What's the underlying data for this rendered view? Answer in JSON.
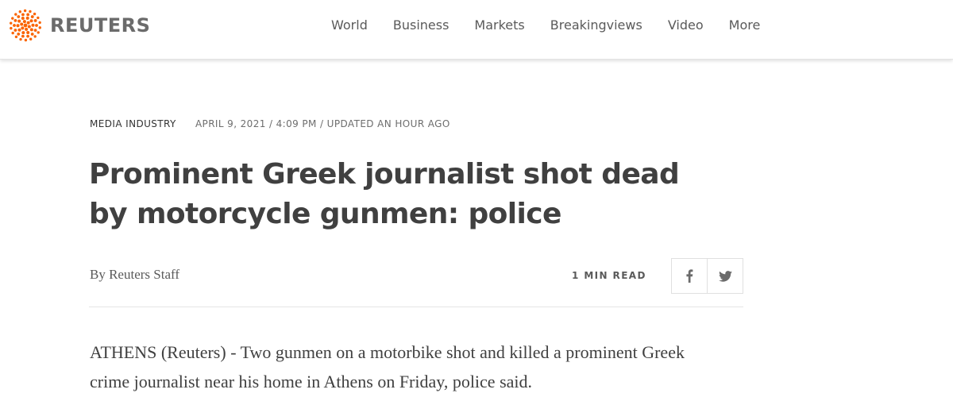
{
  "brand": {
    "name": "REUTERS",
    "logo_icon": "reuters-dot-logo-icon",
    "accent_color": "#fa6400"
  },
  "nav": {
    "items": [
      {
        "label": "World"
      },
      {
        "label": "Business"
      },
      {
        "label": "Markets"
      },
      {
        "label": "Breakingviews"
      },
      {
        "label": "Video"
      },
      {
        "label": "More"
      }
    ]
  },
  "article": {
    "channel": "MEDIA INDUSTRY",
    "timestamp": "APRIL 9, 2021 / 4:09 PM / UPDATED AN HOUR AGO",
    "headline": "Prominent Greek journalist shot dead by motorcycle gunmen: police",
    "byline_prefix": "By",
    "author": "Reuters Staff",
    "read_time": "1 MIN READ",
    "share": [
      {
        "icon": "facebook-icon"
      },
      {
        "icon": "twitter-icon"
      }
    ],
    "body": "ATHENS (Reuters) - Two gunmen on a motorbike shot and killed a prominent Greek crime journalist near his home in Athens on Friday, police said."
  }
}
